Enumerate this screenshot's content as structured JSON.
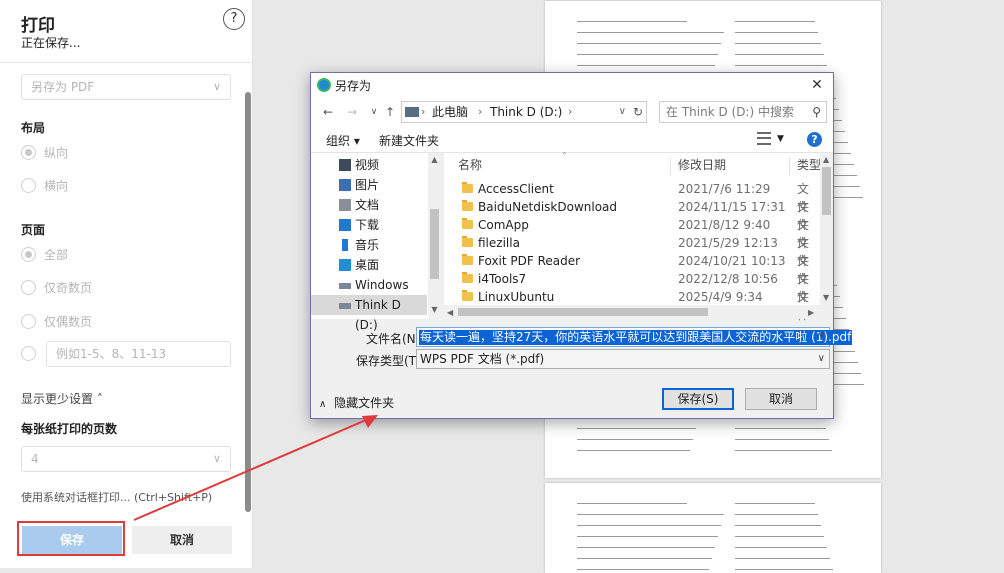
{
  "print_panel": {
    "title": "打印",
    "subtitle": "正在保存...",
    "help": "?",
    "destination": "另存为 PDF",
    "layout_label": "布局",
    "layout_options": [
      "纵向",
      "横向"
    ],
    "pages_label": "页面",
    "pages_options": [
      "全部",
      "仅奇数页",
      "仅偶数页"
    ],
    "custom_pages_placeholder": "例如1-5、8、11-13",
    "more_settings": "显示更少设置 ˄",
    "pages_per_sheet_label": "每张纸打印的页数",
    "pages_per_sheet_value": "4",
    "system_dialog": "使用系统对话框打印... (Ctrl+Shift+P)",
    "save_button": "保存",
    "cancel_button": "取消"
  },
  "dialog": {
    "title": "另存为",
    "close": "✕",
    "address": [
      "此电脑",
      "Think D (D:)"
    ],
    "search_placeholder": "在 Think D (D:) 中搜索",
    "toolbar": {
      "organize": "组织 ▾",
      "new_folder": "新建文件夹"
    },
    "nav_items": [
      {
        "label": "视频",
        "icon": "video-icon"
      },
      {
        "label": "图片",
        "icon": "pictures-icon"
      },
      {
        "label": "文档",
        "icon": "documents-icon"
      },
      {
        "label": "下载",
        "icon": "download-icon"
      },
      {
        "label": "音乐",
        "icon": "music-icon"
      },
      {
        "label": "桌面",
        "icon": "desktop-icon"
      },
      {
        "label": "Windows (C:)",
        "icon": "drive-icon"
      },
      {
        "label": "Think D (D:)",
        "icon": "drive-icon"
      }
    ],
    "columns": {
      "name": "名称",
      "date": "修改日期",
      "type": "类型"
    },
    "files": [
      {
        "name": "AccessClient",
        "date": "2021/7/6 11:29",
        "type": "文件"
      },
      {
        "name": "BaiduNetdiskDownload",
        "date": "2024/11/15 17:31",
        "type": "文件"
      },
      {
        "name": "ComApp",
        "date": "2021/8/12 9:40",
        "type": "文件"
      },
      {
        "name": "filezilla",
        "date": "2021/5/29 12:13",
        "type": "文件"
      },
      {
        "name": "Foxit PDF Reader",
        "date": "2024/10/21 10:13",
        "type": "文件"
      },
      {
        "name": "i4Tools7",
        "date": "2022/12/8 10:56",
        "type": "文件"
      },
      {
        "name": "LinuxUbuntu",
        "date": "2025/4/9 9:34",
        "type": "文件"
      }
    ],
    "filename_label": "文件名(N):",
    "filename_value": "每天读一遍，坚持27天，你的英语水平就可以达到跟美国人交流的水平啦 (1).pdf",
    "filetype_label": "保存类型(T):",
    "filetype_value": "WPS PDF 文档 (*.pdf)",
    "hide_folders": "隐藏文件夹",
    "save_button": "保存(S)",
    "cancel_button": "取消"
  },
  "colors": {
    "accent_blue": "#0a64d6",
    "annotation_red": "#e03a3a",
    "print_save_button": "#a9cbee"
  }
}
